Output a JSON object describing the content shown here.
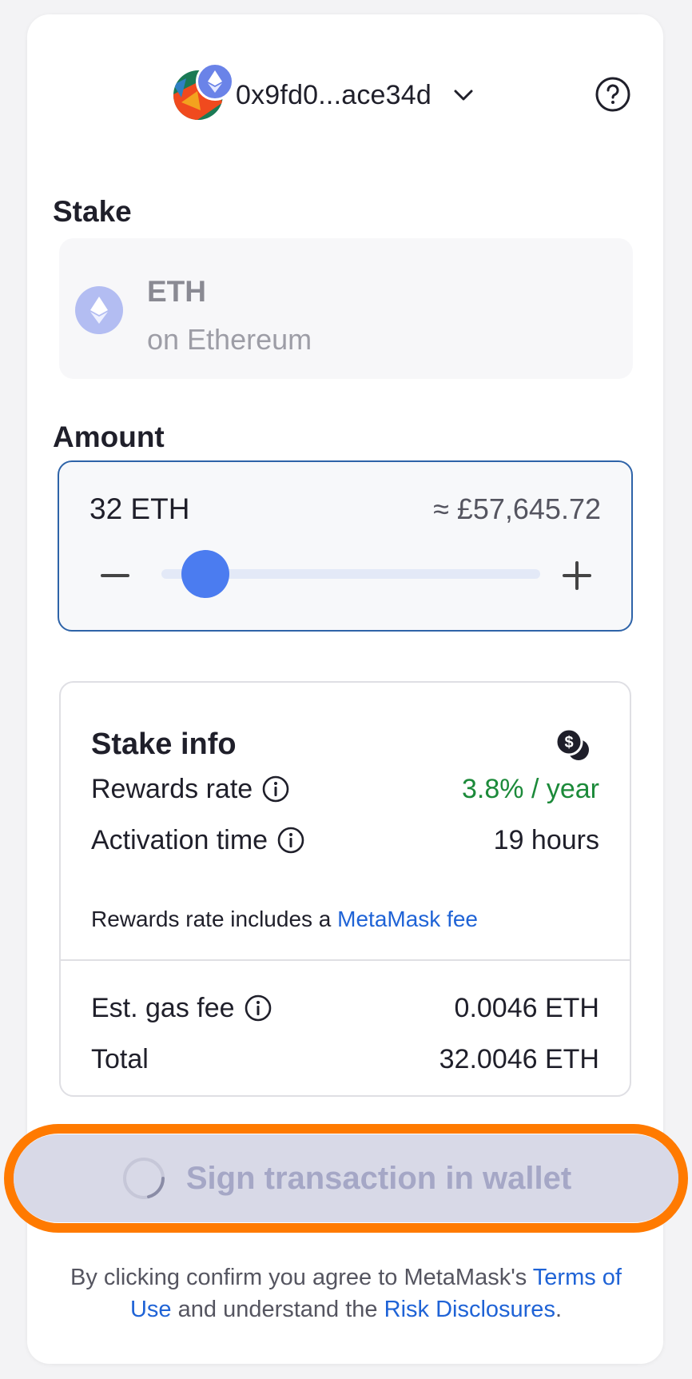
{
  "header": {
    "account_address": "0x9fd0...ace34d",
    "chevron_icon": "chevron-down-icon",
    "help_icon": "question-circle-icon"
  },
  "stake": {
    "label": "Stake",
    "asset_symbol": "ETH",
    "asset_network": "on Ethereum"
  },
  "amount": {
    "label": "Amount",
    "value_text": "32 ETH",
    "fiat_text": "≈ £57,645.72",
    "slider_fraction": 0.06
  },
  "stake_info": {
    "title": "Stake info",
    "rewards_rate_label": "Rewards rate",
    "rewards_rate_value": "3.8% / year",
    "activation_time_label": "Activation time",
    "activation_time_value": "19 hours",
    "note_prefix": "Rewards rate includes a",
    "note_link": "MetaMask fee",
    "gas_fee_label": "Est. gas fee",
    "gas_fee_value": "0.0046 ETH",
    "total_label": "Total",
    "total_value": "32.0046 ETH"
  },
  "cta": {
    "label": "Sign transaction in wallet"
  },
  "footer": {
    "text_prefix": "By clicking confirm you agree to MetaMask's",
    "terms_link": "Terms of Use",
    "text_middle": "and understand the",
    "risk_link": "Risk Disclosures",
    "text_suffix": "."
  },
  "colors": {
    "accent": "#4b7cf0",
    "green": "#1c8a3a",
    "link": "#1f63d6",
    "highlight": "#ff7a00"
  }
}
